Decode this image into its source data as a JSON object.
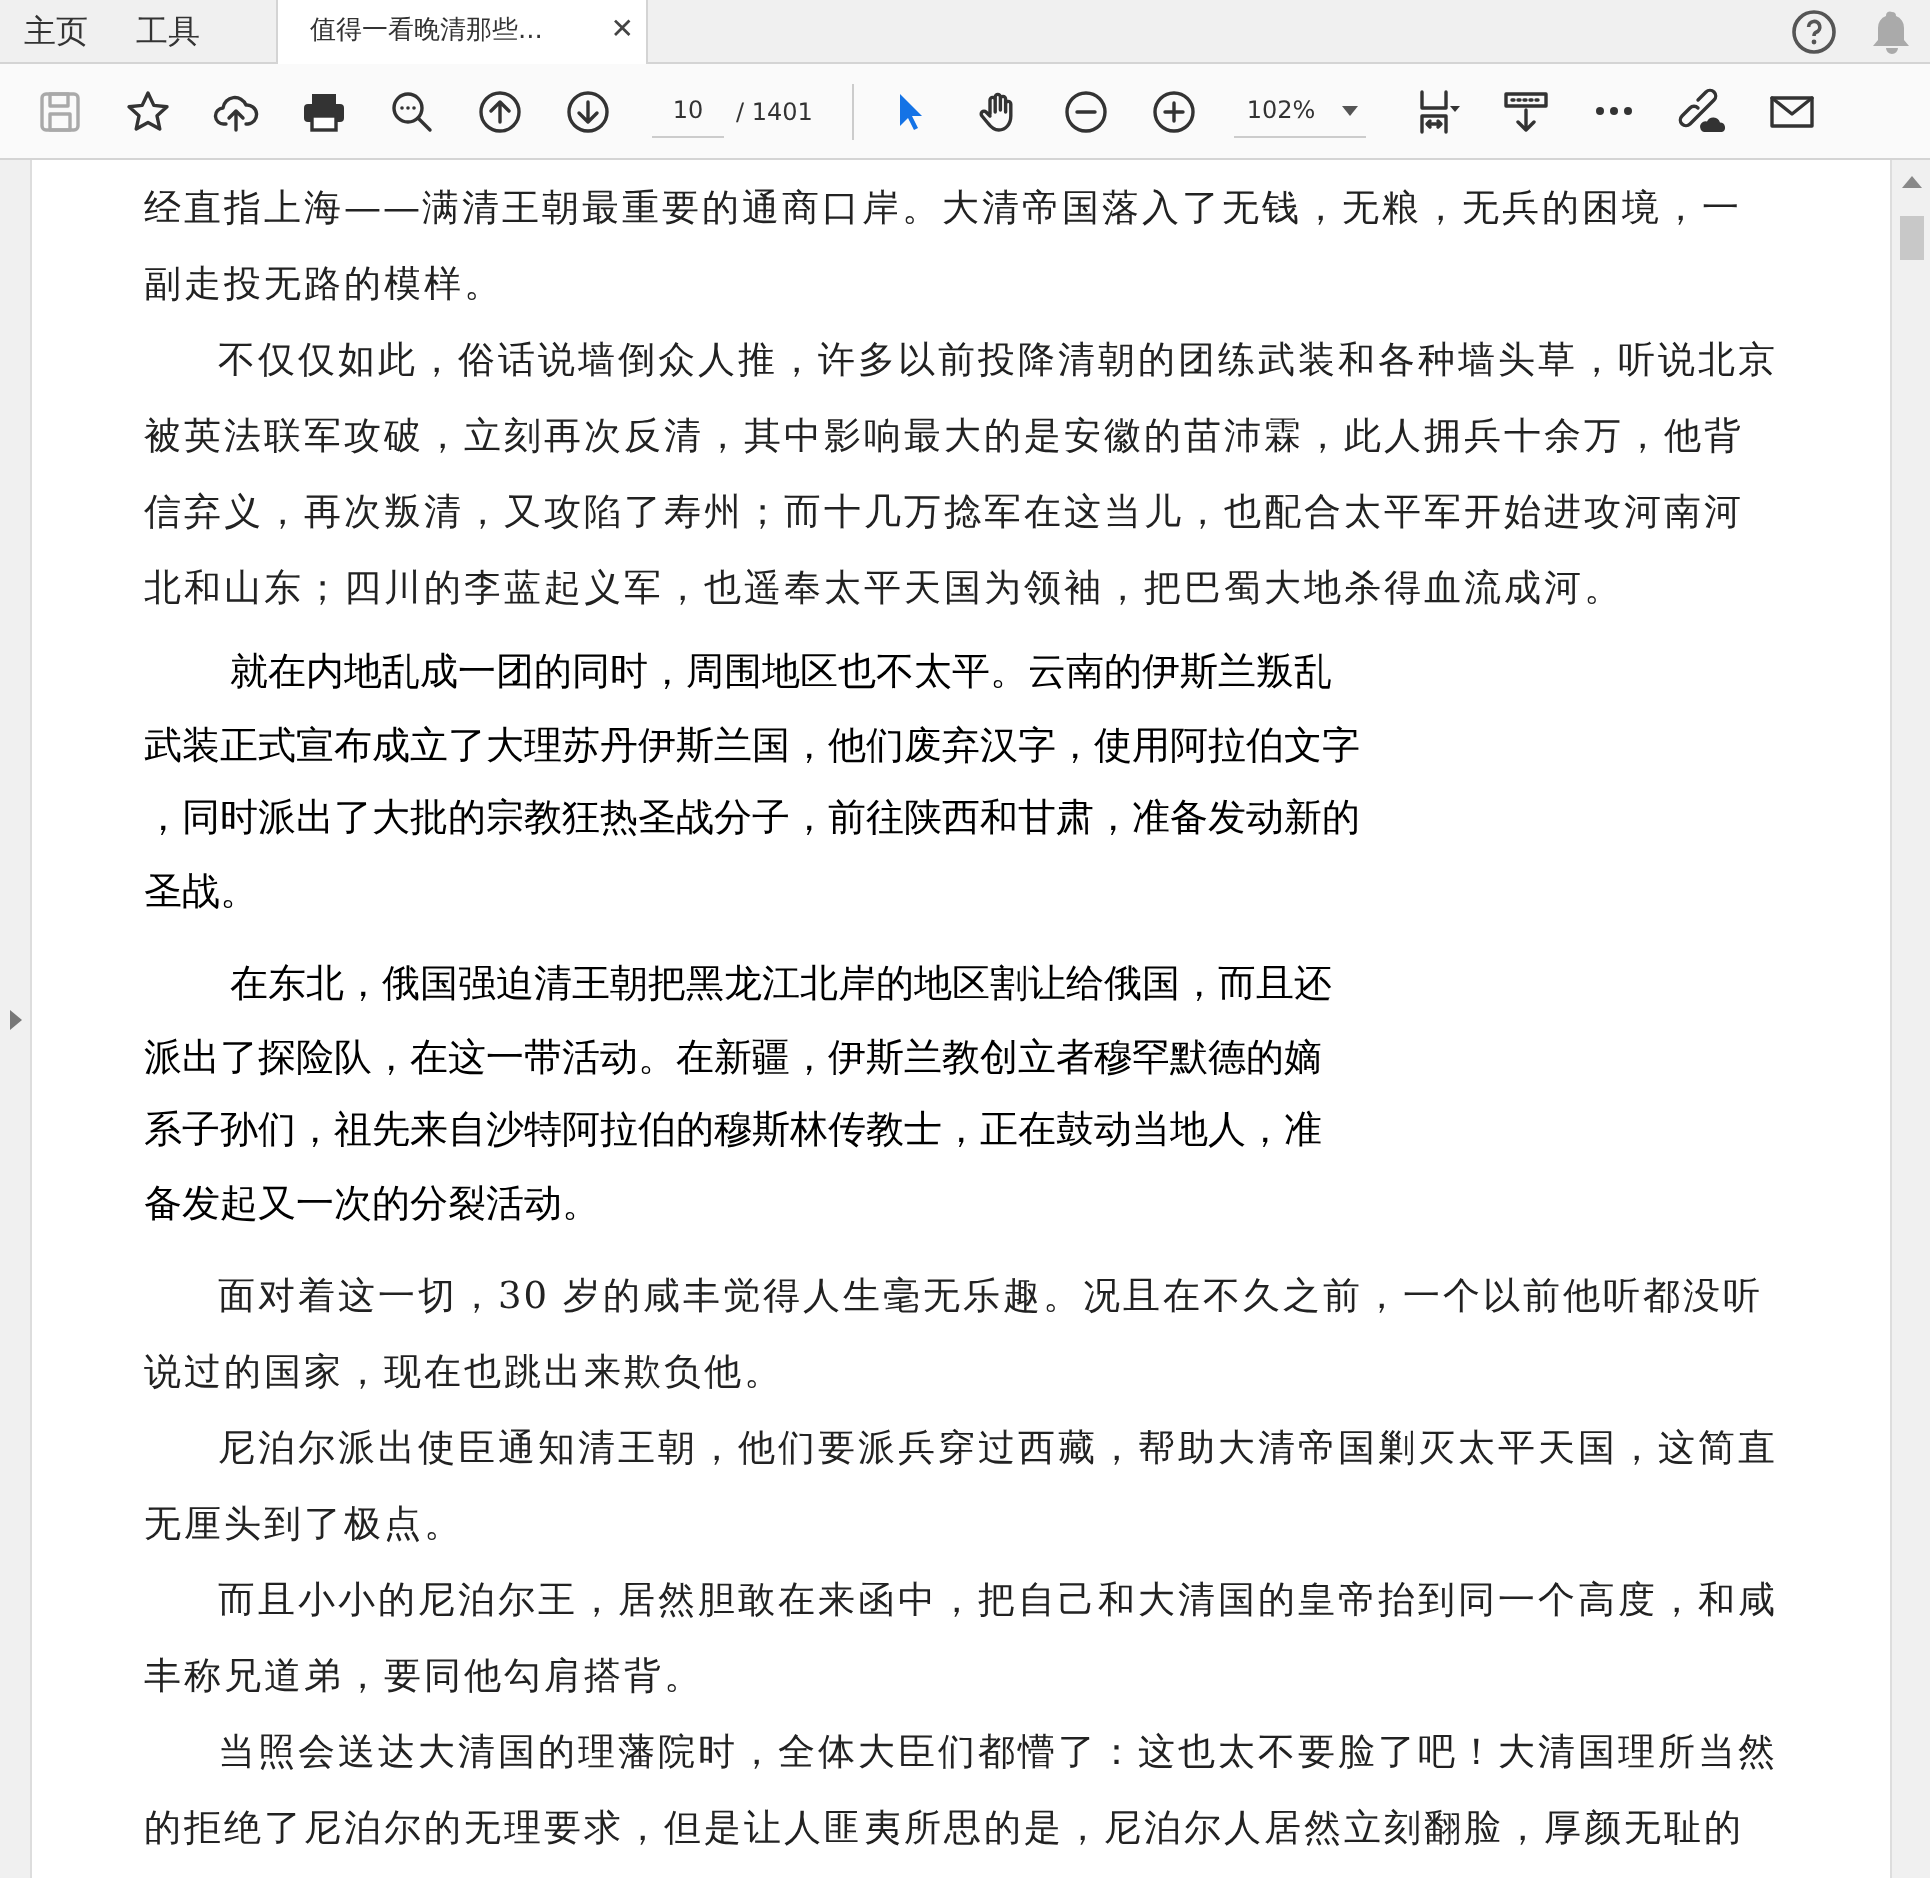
{
  "tabs": [
    {
      "label": "主页",
      "selected": false,
      "kind": "home"
    },
    {
      "label": "工具",
      "selected": false,
      "kind": "home"
    },
    {
      "label": "值得一看晚清那些...",
      "selected": true,
      "kind": "document",
      "close": "✕"
    }
  ],
  "toolbar": {
    "left_tools": [
      {
        "kind": "save",
        "disabled": true
      },
      {
        "kind": "star",
        "disabled": false
      },
      {
        "kind": "upload",
        "disabled": false
      },
      {
        "kind": "print",
        "disabled": false
      },
      {
        "kind": "zoom-search",
        "disabled": false
      },
      {
        "kind": "page-up",
        "disabled": false
      },
      {
        "kind": "page-down",
        "disabled": false
      }
    ],
    "page_number": "10",
    "page_total": "/ 1401",
    "mode_tools": [
      {
        "kind": "pointer",
        "selected": true
      },
      {
        "kind": "hand",
        "selected": false
      }
    ],
    "zoom_tools": [
      {
        "kind": "zoom-out"
      },
      {
        "kind": "zoom-in"
      }
    ],
    "zoom_value": "102%",
    "right_tools": [
      {
        "kind": "layout"
      },
      {
        "kind": "scroll-mode"
      },
      {
        "kind": "more"
      },
      {
        "kind": "link-cloud"
      },
      {
        "kind": "mail"
      }
    ]
  },
  "document": {
    "paragraphs": [
      {
        "kind": "serif",
        "continued": true,
        "lines": [
          "经直指上海——满清王朝最重要的通商口岸。大清帝国落入了无钱，无粮，无兵的困境，一",
          "副走投无路的模样。"
        ]
      },
      {
        "kind": "serif",
        "continued": false,
        "lines": [
          "不仅仅如此，俗话说墙倒众人推，许多以前投降清朝的团练武装和各种墙头草，听说北京",
          "被英法联军攻破，立刻再次反清，其中影响最大的是安徽的苗沛霖，此人拥兵十余万，他背",
          "信弃义，再次叛清，又攻陷了寿州；而十几万捻军在这当儿，也配合太平军开始进攻河南河",
          "北和山东；四川的李蓝起义军，也遥奉太平天国为领袖，把巴蜀大地杀得血流成河。"
        ]
      },
      {
        "kind": "sans",
        "continued": false,
        "lines": [
          "就在内地乱成一团的同时，周围地区也不太平。云南的伊斯兰叛乱",
          "武装正式宣布成立了大理苏丹伊斯兰国，他们废弃汉字，使用阿拉伯文字",
          "，同时派出了大批的宗教狂热圣战分子，前往陕西和甘肃，准备发动新的",
          "圣战。"
        ]
      },
      {
        "kind": "sans",
        "continued": false,
        "lines": [
          "在东北，俄国强迫清王朝把黑龙江北岸的地区割让给俄国，而且还",
          "派出了探险队，在这一带活动。在新疆，伊斯兰教创立者穆罕默德的嫡",
          "系子孙们，祖先来自沙特阿拉伯的穆斯林传教士，正在鼓动当地人，准",
          "备发起又一次的分裂活动。"
        ]
      },
      {
        "kind": "serif",
        "continued": false,
        "lines": [
          "面对着这一切，30 岁的咸丰觉得人生毫无乐趣。况且在不久之前，一个以前他听都没听",
          "说过的国家，现在也跳出来欺负他。"
        ]
      },
      {
        "kind": "serif",
        "continued": false,
        "lines": [
          "尼泊尔派出使臣通知清王朝，他们要派兵穿过西藏，帮助大清帝国剿灭太平天国，这简直",
          "无厘头到了极点。"
        ]
      },
      {
        "kind": "serif",
        "continued": false,
        "lines": [
          "而且小小的尼泊尔王，居然胆敢在来函中，把自己和大清国的皇帝抬到同一个高度，和咸",
          "丰称兄道弟，要同他勾肩搭背。"
        ]
      },
      {
        "kind": "serif",
        "continued": false,
        "lines": [
          "当照会送达大清国的理藩院时，全体大臣们都懵了：这也太不要脸了吧！大清国理所当然",
          "的拒绝了尼泊尔的无理要求，但是让人匪夷所思的是，尼泊尔人居然立刻翻脸，厚颜无耻的"
        ]
      }
    ]
  }
}
